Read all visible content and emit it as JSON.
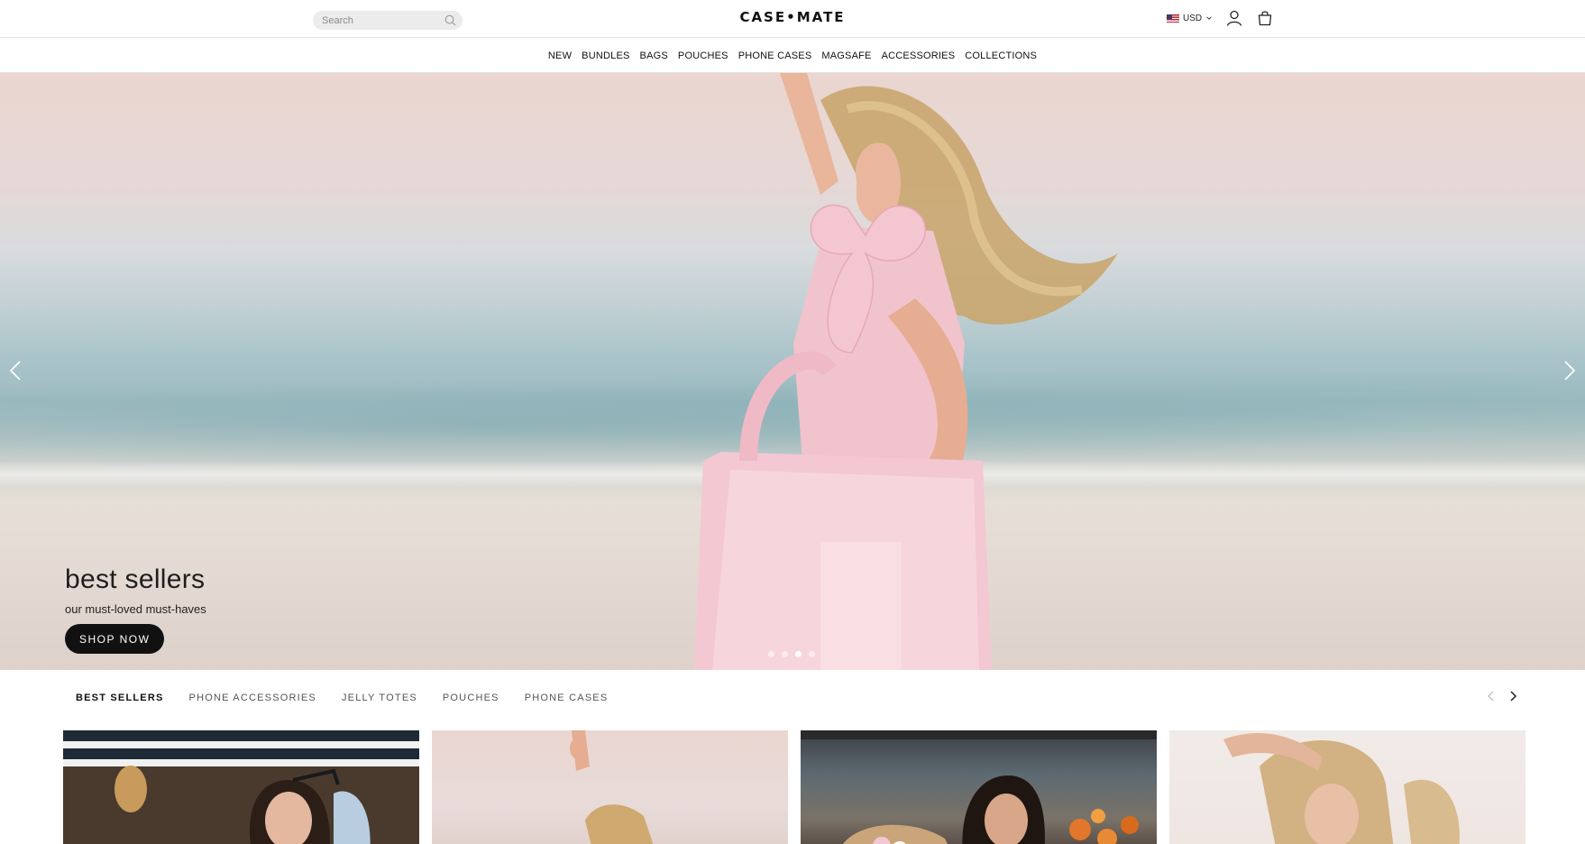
{
  "header": {
    "search_placeholder": "Search",
    "logo": "CASE•MATE",
    "currency": "USD"
  },
  "nav": {
    "items": [
      "NEW",
      "BUNDLES",
      "BAGS",
      "POUCHES",
      "PHONE CASES",
      "MAGSAFE",
      "ACCESSORIES",
      "COLLECTIONS"
    ]
  },
  "hero": {
    "title": "best sellers",
    "subtitle": "our must-loved must-haves",
    "cta": "SHOP NOW",
    "slide_count": 4,
    "active_slide": 3
  },
  "tabs": {
    "items": [
      "BEST SELLERS",
      "PHONE ACCESSORIES",
      "JELLY TOTES",
      "POUCHES",
      "PHONE CASES"
    ],
    "active": 0
  },
  "colors": {
    "accent": "#111111",
    "bag_pink": "#f1c6cf",
    "sea": "#9fbcc1",
    "sand": "#e3d9d2"
  }
}
